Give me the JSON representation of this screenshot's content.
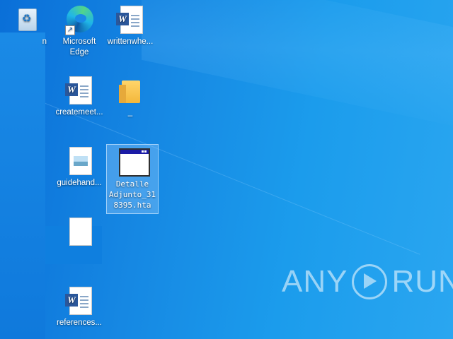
{
  "desktop": {
    "icons": [
      {
        "id": "recycle-bin",
        "label": "n"
      },
      {
        "id": "edge",
        "label": "Microsoft\nEdge"
      },
      {
        "id": "writtenwhe",
        "label": "writtenwhe..."
      },
      {
        "id": "createmeet",
        "label": "createmeet..."
      },
      {
        "id": "folder",
        "label": "_"
      },
      {
        "id": "guidehand",
        "label": "guidehand..."
      },
      {
        "id": "hta",
        "label": "Detalle\nAdjunto_31\n8395.hta"
      },
      {
        "id": "references",
        "label": "references..."
      }
    ]
  },
  "watermark": {
    "left": "ANY",
    "right": "RUN"
  },
  "colors": {
    "accent": "#1688e3",
    "word": "#2b579a"
  }
}
